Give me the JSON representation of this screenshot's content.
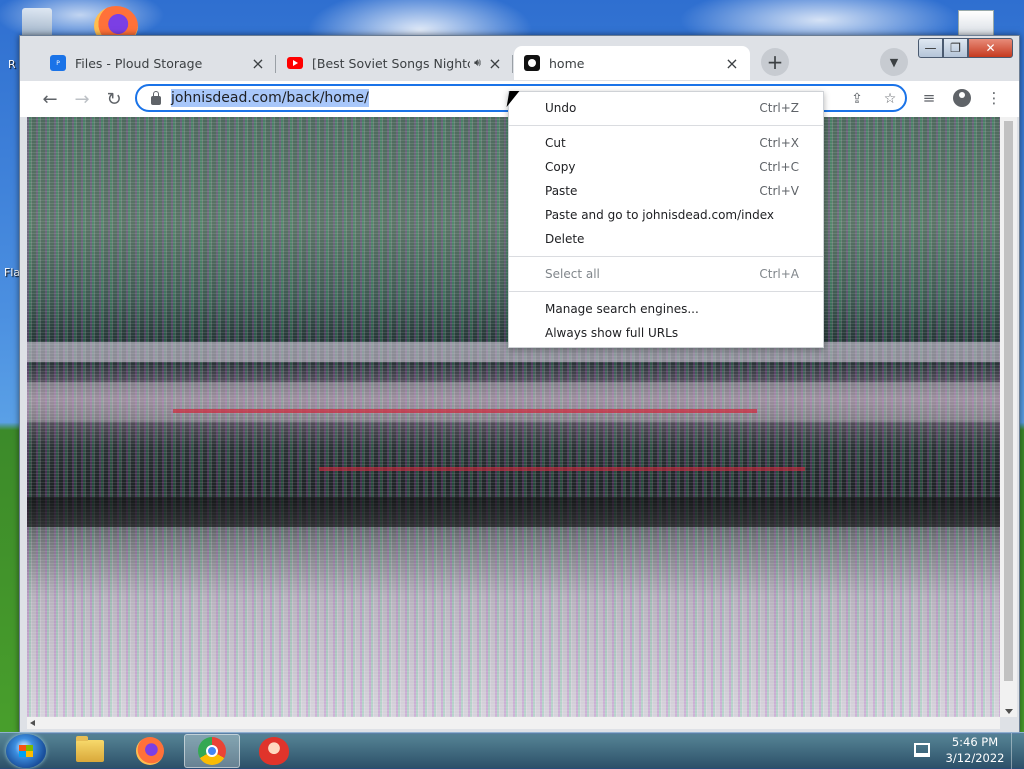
{
  "desktop": {
    "icon_label_partial_1": "R",
    "icon_label_partial_2": "Fla"
  },
  "tabs": [
    {
      "title": "Files - Ploud Storage",
      "favicon": "ploud-icon",
      "active": false
    },
    {
      "title": "[Best Soviet Songs Nightcore",
      "favicon": "youtube-icon",
      "audio": "speaker-icon",
      "active": false
    },
    {
      "title": "home",
      "favicon": "home-skull-icon",
      "active": true
    }
  ],
  "toolbar": {
    "url": "johnisdead.com/back/home/",
    "new_tab_symbol": "+",
    "tab_search_symbol": "⌄"
  },
  "window_controls": {
    "minimize": "—",
    "maximize": "❐",
    "close": "✕"
  },
  "context_menu": {
    "items": [
      {
        "label": "Undo",
        "shortcut": "Ctrl+Z",
        "enabled": true
      },
      {
        "label": "Cut",
        "shortcut": "Ctrl+X",
        "enabled": true
      },
      {
        "label": "Copy",
        "shortcut": "Ctrl+C",
        "enabled": true
      },
      {
        "label": "Paste",
        "shortcut": "Ctrl+V",
        "enabled": true
      },
      {
        "label": "Paste and go to johnisdead.com/index",
        "shortcut": "",
        "enabled": true
      },
      {
        "label": "Delete",
        "shortcut": "",
        "enabled": true
      },
      {
        "label": "Select all",
        "shortcut": "Ctrl+A",
        "enabled": false
      },
      {
        "label": "Manage search engines...",
        "shortcut": "",
        "enabled": true
      },
      {
        "label": "Always show full URLs",
        "shortcut": "",
        "enabled": true
      }
    ]
  },
  "taskbar": {
    "apps": [
      "file-explorer-icon",
      "firefox-icon",
      "chrome-icon",
      "mascot-app-icon"
    ],
    "active_app": "chrome-icon",
    "clock_time": "5:46 PM",
    "clock_date": "3/12/2022"
  },
  "colors": {
    "accent": "#1a73e8",
    "url_selection": "#a8c7fa",
    "close_button": "#c53a1f"
  }
}
